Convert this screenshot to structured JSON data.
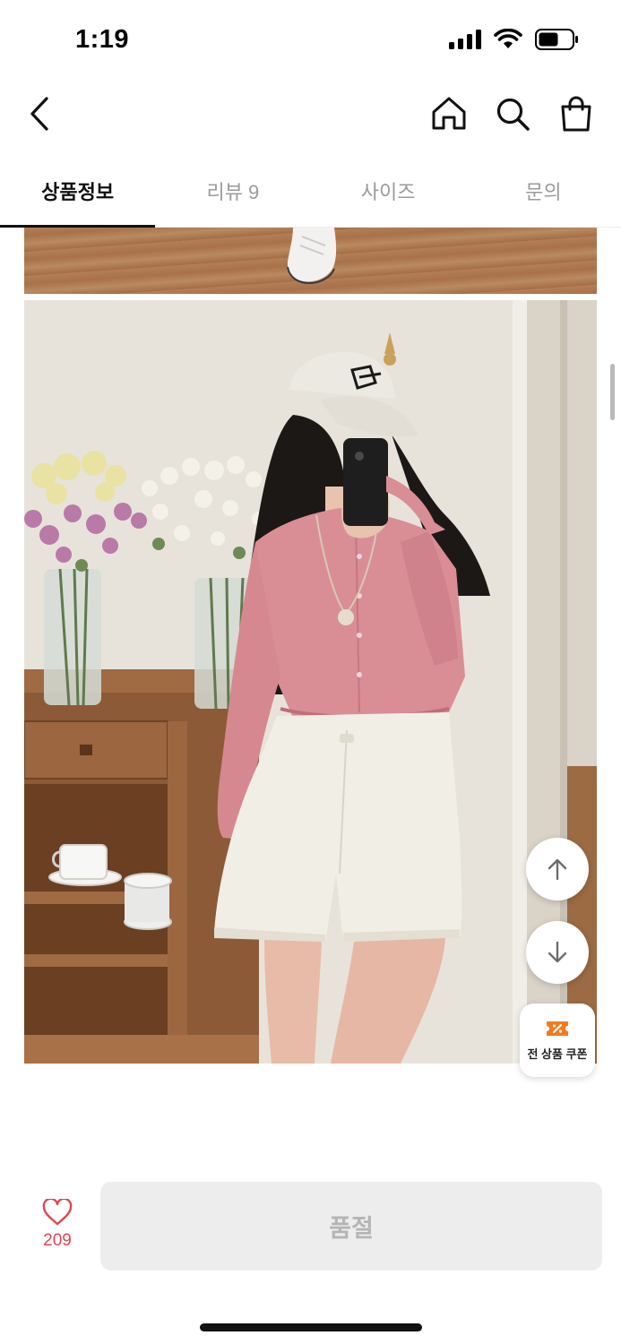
{
  "status_bar": {
    "time": "1:19",
    "icons": [
      "signal-icon",
      "wifi-icon",
      "battery-icon"
    ]
  },
  "nav": {
    "icons": [
      "back-icon",
      "home-icon",
      "search-icon",
      "shopping-bag-icon"
    ]
  },
  "tabs": [
    {
      "label": "상품정보",
      "active": true
    },
    {
      "label": "리뷰 9",
      "active": false
    },
    {
      "label": "사이즈",
      "active": false
    },
    {
      "label": "문의",
      "active": false
    }
  ],
  "floating": {
    "up_icon": "arrow-up-icon",
    "down_icon": "arrow-down-icon",
    "coupon_label": "전 상품 쿠폰",
    "coupon_icon": "coupon-ticket-icon"
  },
  "bottom_bar": {
    "like_count": "209",
    "like_icon": "heart-icon",
    "soldout_label": "품절"
  },
  "colors": {
    "accent_red": "#e2454f",
    "coupon_orange": "#f47a20",
    "disabled_bg": "#ededed",
    "disabled_text": "#b5b5b5"
  }
}
